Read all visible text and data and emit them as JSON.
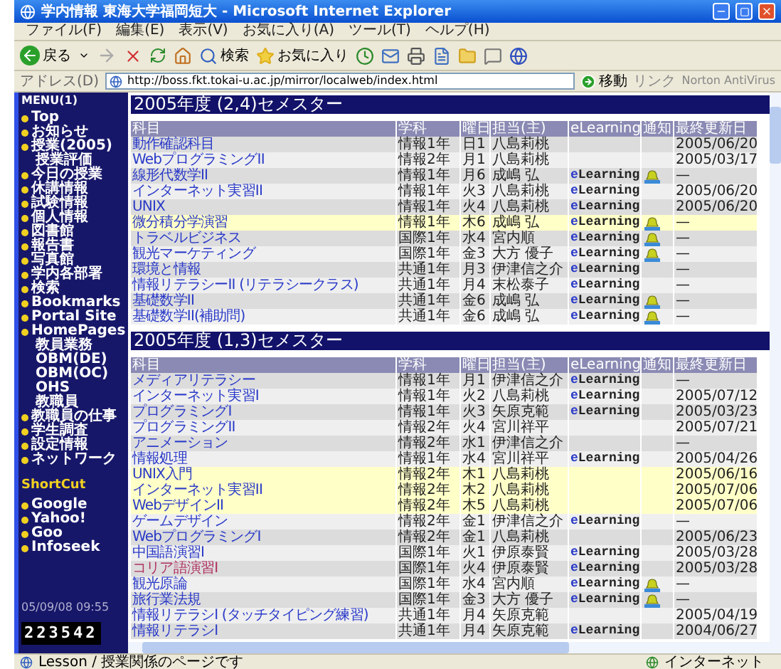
{
  "window": {
    "title": "学内情報 東海大学福岡短大 - Microsoft Internet Explorer"
  },
  "menu": [
    "ファイル(F)",
    "編集(E)",
    "表示(V)",
    "お気に入り(A)",
    "ツール(T)",
    "ヘルプ(H)"
  ],
  "toolbar": {
    "back": "戻る",
    "search": "検索",
    "favorites": "お気に入り"
  },
  "address_bar": {
    "label": "アドレス(D)",
    "value": "http://boss.fkt.tokai-u.ac.jp/mirror/localweb/index.html",
    "go": "移動",
    "links": "リンク",
    "norton": "Norton AntiVirus"
  },
  "sidebar": {
    "title": "MENU(1)",
    "items": [
      {
        "label": "Top"
      },
      {
        "label": "お知らせ"
      },
      {
        "label": "授業(2005)",
        "children": [
          {
            "label": "授業評価"
          }
        ]
      },
      {
        "label": "今日の授業"
      },
      {
        "label": "休講情報"
      },
      {
        "label": "試験情報"
      },
      {
        "label": "個人情報"
      },
      {
        "label": "図書館"
      },
      {
        "label": "報告書"
      },
      {
        "label": "写真館"
      },
      {
        "label": "学内各部署"
      },
      {
        "label": "検索"
      },
      {
        "label": "Bookmarks"
      },
      {
        "label": "Portal Site"
      },
      {
        "label": "HomePages",
        "children": [
          {
            "label": "教員業務"
          },
          {
            "label": "OBM(DE)"
          },
          {
            "label": "OBM(OC)"
          },
          {
            "label": "OHS"
          },
          {
            "label": "教職員"
          }
        ]
      },
      {
        "label": "教職員の仕事"
      },
      {
        "label": "学生調査"
      },
      {
        "label": "設定情報"
      },
      {
        "label": "ネットワーク"
      }
    ],
    "shortcut_title": "ShortCut",
    "shortcuts": [
      {
        "label": "Google"
      },
      {
        "label": "Yahoo!"
      },
      {
        "label": "Goo"
      },
      {
        "label": "Infoseek"
      }
    ],
    "datetime": "05/09/08 09:55",
    "counter": "223542"
  },
  "sections": [
    {
      "title": "2005年度 (2,4)セメスター",
      "columns": [
        "科目",
        "学科",
        "曜日",
        "担当(主)",
        "eLearning",
        "通知",
        "最終更新日"
      ],
      "rows": [
        {
          "subject": "動作確認科目",
          "dept": "情報1年",
          "day": "日1",
          "teacher": "八島莉桃",
          "date": "2005/06/20",
          "icon": false,
          "highlighted": false,
          "visited": false
        },
        {
          "subject": "WebプログラミングII",
          "dept": "情報2年",
          "day": "月1",
          "teacher": "八島莉桃",
          "date": "2005/03/17",
          "icon": false,
          "highlighted": false,
          "visited": false
        },
        {
          "subject": "線形代数学II",
          "dept": "情報1年",
          "day": "月6",
          "teacher": "成嶋 弘",
          "elearning": "eLearning",
          "date": "—",
          "icon": true,
          "highlighted": false,
          "visited": false
        },
        {
          "subject": "インターネット実習II",
          "dept": "情報1年",
          "day": "火3",
          "teacher": "八島莉桃",
          "elearning": "eLearning",
          "date": "2005/06/20",
          "icon": false,
          "highlighted": false,
          "visited": false
        },
        {
          "subject": "UNIX",
          "dept": "情報1年",
          "day": "火4",
          "teacher": "八島莉桃",
          "elearning": "eLearning",
          "date": "2005/06/20",
          "icon": false,
          "highlighted": false,
          "visited": false
        },
        {
          "subject": "微分積分学演習",
          "dept": "情報1年",
          "day": "木6",
          "teacher": "成嶋 弘",
          "elearning": "eLearning",
          "date": "—",
          "icon": true,
          "highlighted": true,
          "visited": false
        },
        {
          "subject": "トラベルビジネス",
          "dept": "国際1年",
          "day": "水4",
          "teacher": "宮内順",
          "elearning": "eLearning",
          "date": "—",
          "icon": true,
          "highlighted": false,
          "visited": false
        },
        {
          "subject": "観光マーケティング",
          "dept": "国際1年",
          "day": "金3",
          "teacher": "大方 優子",
          "elearning": "eLearning",
          "date": "—",
          "icon": true,
          "highlighted": false,
          "visited": false
        },
        {
          "subject": "環境と情報",
          "dept": "共通1年",
          "day": "月3",
          "teacher": "伊津信之介",
          "elearning": "eLearning",
          "date": "—",
          "icon": false,
          "highlighted": false,
          "visited": false
        },
        {
          "subject": "情報リテラシーII (リテラシークラス)",
          "dept": "共通1年",
          "day": "月4",
          "teacher": "末松泰子",
          "elearning": "eLearning",
          "date": "—",
          "icon": false,
          "highlighted": false,
          "visited": false
        },
        {
          "subject": "基礎数学II",
          "dept": "共通1年",
          "day": "金6",
          "teacher": "成嶋 弘",
          "elearning": "eLearning",
          "date": "—",
          "icon": true,
          "highlighted": false,
          "visited": false
        },
        {
          "subject": "基礎数学II(補助問)",
          "dept": "共通1年",
          "day": "金6",
          "teacher": "成嶋 弘",
          "elearning": "eLearning",
          "date": "—",
          "icon": true,
          "highlighted": false,
          "visited": false
        }
      ]
    },
    {
      "title": "2005年度 (1,3)セメスター",
      "columns": [
        "科目",
        "学科",
        "曜日",
        "担当(主)",
        "eLearning",
        "通知",
        "最終更新日"
      ],
      "rows": [
        {
          "subject": "メディアリテラシー",
          "dept": "情報1年",
          "day": "月1",
          "teacher": "伊津信之介",
          "elearning": "eLearning",
          "date": "—",
          "icon": false,
          "highlighted": false,
          "visited": false
        },
        {
          "subject": "インターネット実習I",
          "dept": "情報1年",
          "day": "火2",
          "teacher": "八島莉桃",
          "elearning": "eLearning",
          "date": "2005/07/12",
          "icon": false,
          "highlighted": false,
          "visited": false
        },
        {
          "subject": "プログラミングI",
          "dept": "情報1年",
          "day": "火3",
          "teacher": "矢原克範",
          "elearning": "eLearning",
          "date": "2005/03/23",
          "icon": false,
          "highlighted": false,
          "visited": false
        },
        {
          "subject": "プログラミングII",
          "dept": "情報2年",
          "day": "火4",
          "teacher": "宮川祥平",
          "date": "2005/07/21",
          "icon": false,
          "highlighted": false,
          "visited": false
        },
        {
          "subject": "アニメーション",
          "dept": "情報2年",
          "day": "水1",
          "teacher": "伊津信之介",
          "date": "—",
          "icon": false,
          "highlighted": false,
          "visited": false
        },
        {
          "subject": "情報処理",
          "dept": "情報1年",
          "day": "水4",
          "teacher": "宮川祥平",
          "elearning": "eLearning",
          "date": "2005/04/26",
          "icon": false,
          "highlighted": false,
          "visited": false
        },
        {
          "subject": "UNIX入門",
          "dept": "情報2年",
          "day": "木1",
          "teacher": "八島莉桃",
          "date": "2005/06/16",
          "icon": false,
          "highlighted": true,
          "visited": false
        },
        {
          "subject": "インターネット実習II",
          "dept": "情報2年",
          "day": "木2",
          "teacher": "八島莉桃",
          "date": "2005/07/06",
          "icon": false,
          "highlighted": true,
          "visited": false
        },
        {
          "subject": "WebデザインII",
          "dept": "情報2年",
          "day": "木5",
          "teacher": "八島莉桃",
          "date": "2005/07/06",
          "icon": false,
          "highlighted": true,
          "visited": false
        },
        {
          "subject": "ゲームデザイン",
          "dept": "情報2年",
          "day": "金1",
          "teacher": "伊津信之介",
          "elearning": "eLearning",
          "date": "—",
          "icon": false,
          "highlighted": false,
          "visited": false
        },
        {
          "subject": "WebプログラミングI",
          "dept": "情報2年",
          "day": "金1",
          "teacher": "八島莉桃",
          "date": "2005/06/23",
          "icon": false,
          "highlighted": false,
          "visited": false
        },
        {
          "subject": "中国語演習I",
          "dept": "国際1年",
          "day": "火1",
          "teacher": "伊原泰賢",
          "elearning": "eLearning",
          "date": "2005/03/28",
          "icon": false,
          "highlighted": false,
          "visited": false
        },
        {
          "subject": "コリア語演習I",
          "dept": "国際1年",
          "day": "火4",
          "teacher": "伊原泰賢",
          "elearning": "eLearning",
          "date": "2005/03/28",
          "icon": false,
          "highlighted": false,
          "visited": true
        },
        {
          "subject": "観光原論",
          "dept": "国際1年",
          "day": "水4",
          "teacher": "宮内順",
          "elearning": "eLearning",
          "date": "—",
          "icon": true,
          "highlighted": false,
          "visited": false
        },
        {
          "subject": "旅行業法規",
          "dept": "国際1年",
          "day": "金3",
          "teacher": "大方 優子",
          "elearning": "eLearning",
          "date": "—",
          "icon": true,
          "highlighted": false,
          "visited": false
        },
        {
          "subject": "情報リテラシI (タッチタイピング練習)",
          "dept": "共通1年",
          "day": "月4",
          "teacher": "矢原克範",
          "date": "2005/04/19",
          "icon": false,
          "highlighted": false,
          "visited": false
        },
        {
          "subject": "情報リテラシI",
          "dept": "共通1年",
          "day": "月4",
          "teacher": "矢原克範",
          "elearning": "eLearning",
          "date": "2004/06/27",
          "icon": false,
          "highlighted": false,
          "visited": false
        }
      ]
    }
  ],
  "status_bar": {
    "text": "Lesson / 授業関係のページです",
    "zone": "インターネット"
  }
}
